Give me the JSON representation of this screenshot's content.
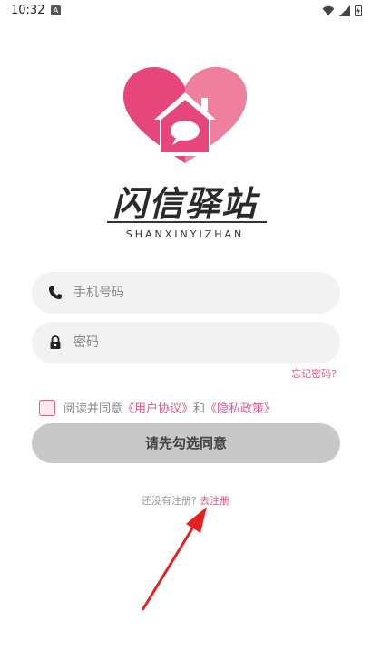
{
  "status": {
    "time": "10:32",
    "notif_icon": "A"
  },
  "logo": {
    "title": "闪信驿站",
    "subtitle": "SHANXINYIZHAN"
  },
  "form": {
    "phone_placeholder": "手机号码",
    "password_placeholder": "密码",
    "forgot_label": "忘记密码?"
  },
  "agreement": {
    "prefix": "阅读并同意",
    "user_agreement": "《用户协议》",
    "and": "和",
    "privacy_policy": "《隐私政策》"
  },
  "submit_label": "请先勾选同意",
  "register": {
    "prompt": "还没有注册?",
    "link": "去注册"
  },
  "colors": {
    "accent": "#e8578a",
    "button_disabled": "#c8c8c8",
    "field_bg": "#f2f2f2",
    "arrow": "#e52222"
  }
}
